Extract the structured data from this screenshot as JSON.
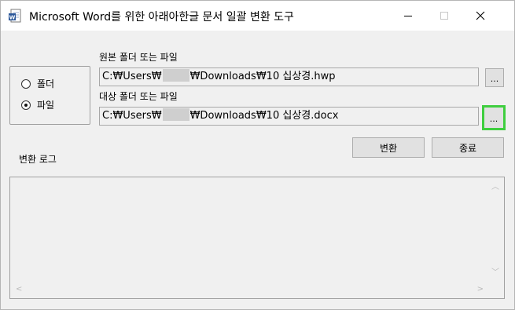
{
  "window": {
    "title": "Microsoft Word를 위한 아래아한글 문서 일괄 변환 도구",
    "app_icon": "word-doc-icon",
    "controls": {
      "minimize": "minimize-icon",
      "maximize": "maximize-icon",
      "close": "close-icon"
    }
  },
  "mode_group": {
    "options": [
      {
        "label": "폴더",
        "selected": false
      },
      {
        "label": "파일",
        "selected": true
      }
    ]
  },
  "source": {
    "label": "원본 폴더 또는 파일",
    "path_prefix": "C:₩Users₩",
    "path_suffix": "₩Downloads₩10 십상경.hwp",
    "browse_label": "..."
  },
  "target": {
    "label": "대상 폴더 또는 파일",
    "path_prefix": "C:₩Users₩",
    "path_suffix": "₩Downloads₩10 십상경.docx",
    "browse_label": "..."
  },
  "actions": {
    "convert_label": "변환",
    "exit_label": "종료"
  },
  "log": {
    "label": "변환 로그"
  },
  "colors": {
    "focus_highlight": "#3fce3f",
    "dialog_bg": "#f0f0f0",
    "button_bg": "#e1e1e1"
  }
}
